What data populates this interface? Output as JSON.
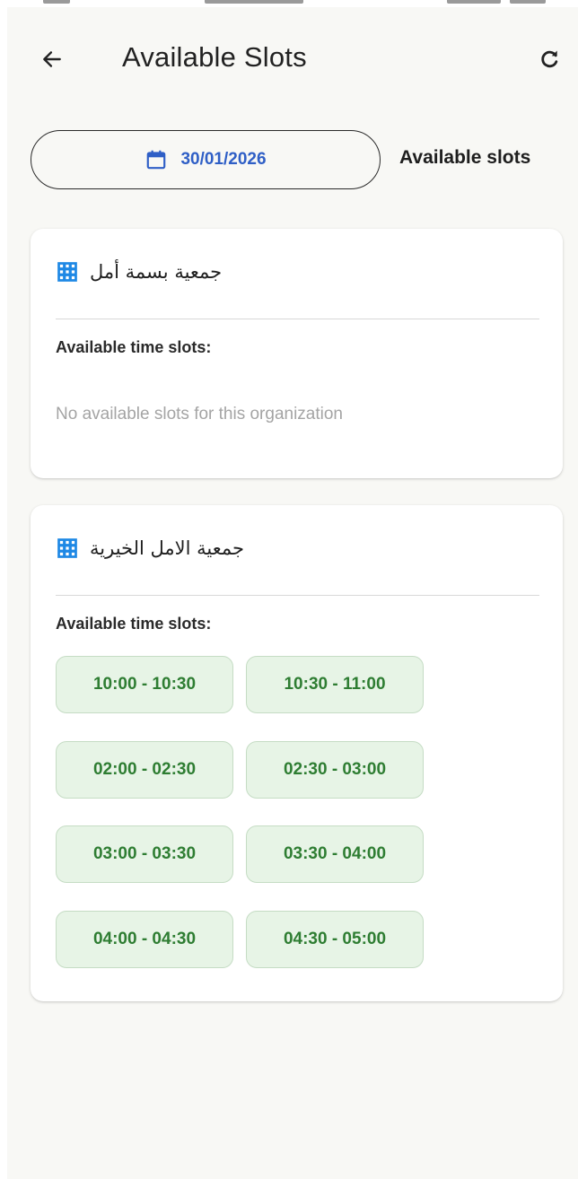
{
  "appbar": {
    "title": "Available Slots",
    "back_icon": "arrow-left-icon",
    "refresh_icon": "refresh-icon"
  },
  "date_picker": {
    "icon": "calendar-icon",
    "value": "30/01/2026"
  },
  "section_title": "Available slots",
  "colors": {
    "accent_blue": "#2f5fc6",
    "slot_green_text": "#2e7d32",
    "slot_green_bg": "#e7f4e6",
    "org_icon_blue": "#1e88e5"
  },
  "organizations": [
    {
      "name": "جمعية بسمة أمل",
      "icon": "building-icon",
      "slots_label": "Available time slots:",
      "empty_message": "No available slots for this organization",
      "slots": []
    },
    {
      "name": "جمعية الامل الخيرية",
      "icon": "building-icon",
      "slots_label": "Available time slots:",
      "slots": [
        "10:00 - 10:30",
        "10:30 - 11:00",
        "02:00 - 02:30",
        "02:30 - 03:00",
        "03:00 - 03:30",
        "03:30 - 04:00",
        "04:00 - 04:30",
        "04:30 - 05:00"
      ]
    }
  ]
}
